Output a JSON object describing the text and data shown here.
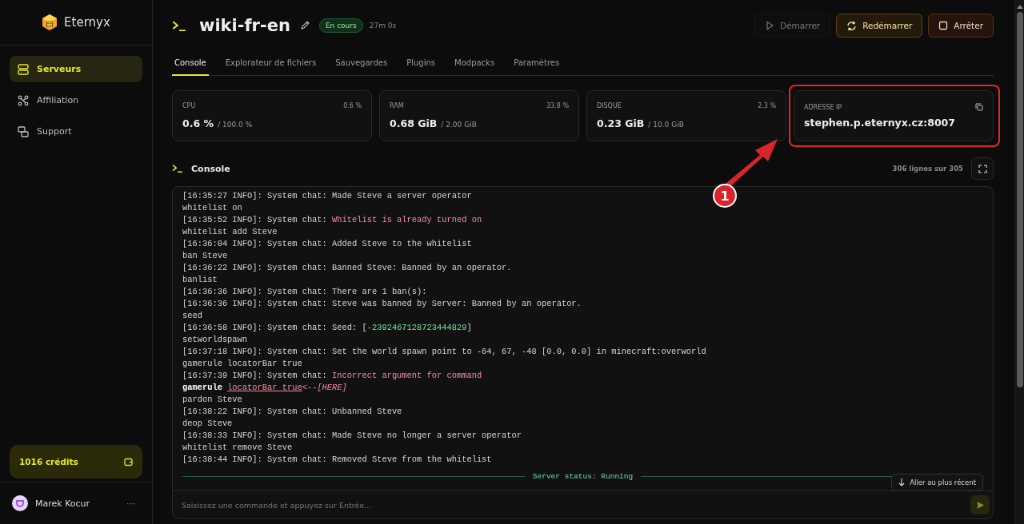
{
  "sidebar": {
    "brand": "Eternyx",
    "items": [
      {
        "label": "Serveurs",
        "selected": true
      },
      {
        "label": "Affiliation",
        "selected": false
      },
      {
        "label": "Support",
        "selected": false
      }
    ],
    "credits": "1016 crédits",
    "user": {
      "name": "Marek Kocur",
      "more": "···"
    }
  },
  "header": {
    "title": "wiki-fr-en",
    "status": "En cours",
    "uptime": "27m 0s",
    "buttons": [
      {
        "label": "Démarrer",
        "kind": "start",
        "disabled": true
      },
      {
        "label": "Redémarrer",
        "kind": "restart",
        "disabled": false
      },
      {
        "label": "Arrêter",
        "kind": "stop",
        "disabled": false
      }
    ]
  },
  "tabs": [
    {
      "label": "Console",
      "selected": true
    },
    {
      "label": "Explorateur de fichiers",
      "selected": false
    },
    {
      "label": "Sauvegardes",
      "selected": false
    },
    {
      "label": "Plugins",
      "selected": false
    },
    {
      "label": "Modpacks",
      "selected": false
    },
    {
      "label": "Paramètres",
      "selected": false
    }
  ],
  "stats": [
    {
      "kind": "usage",
      "label": "CPU",
      "percent": "0.6 %",
      "value": "0.6 %",
      "total": "/ 100.0 %"
    },
    {
      "kind": "usage",
      "label": "RAM",
      "percent": "33.8 %",
      "value": "0.68 GiB",
      "total": "/ 2.00 GiB"
    },
    {
      "kind": "usage",
      "label": "DISQUE",
      "percent": "2.3 %",
      "value": "0.23 GiB",
      "total": "/ 10.0 GiB"
    },
    {
      "kind": "address",
      "label": "ADRESSE IP",
      "value": "stephen.p.eternyx.cz:8007"
    }
  ],
  "annotation": {
    "number": "1"
  },
  "console": {
    "title": "Console",
    "line_count": "306 lignes sur 305",
    "lines": [
      [
        {
          "text": "[16:35:27 INFO]: System chat: Made Steve a server operator",
          "kind": "plain"
        }
      ],
      [
        {
          "text": "whitelist on",
          "kind": "plain"
        }
      ],
      [
        {
          "text": "[16:35:52 INFO]: System chat: ",
          "kind": "plain"
        },
        {
          "text": "Whitelist is already turned on",
          "kind": "error"
        }
      ],
      [
        {
          "text": "whitelist add Steve",
          "kind": "plain"
        }
      ],
      [
        {
          "text": "[16:36:04 INFO]: System chat: Added Steve to the whitelist",
          "kind": "plain"
        }
      ],
      [
        {
          "text": "ban Steve",
          "kind": "plain"
        }
      ],
      [
        {
          "text": "[16:36:22 INFO]: System chat: Banned Steve: Banned by an operator.",
          "kind": "plain"
        }
      ],
      [
        {
          "text": "banlist",
          "kind": "plain"
        }
      ],
      [
        {
          "text": "[16:36:36 INFO]: System chat: There are 1 ban(s):",
          "kind": "plain"
        }
      ],
      [
        {
          "text": "[16:36:36 INFO]: System chat: Steve was banned by Server: Banned by an operator.",
          "kind": "plain"
        }
      ],
      [
        {
          "text": "seed",
          "kind": "plain"
        }
      ],
      [
        {
          "text": "[16:36:58 INFO]: System chat: Seed: [",
          "kind": "plain"
        },
        {
          "text": "-2392467128723444829",
          "kind": "number"
        },
        {
          "text": "]",
          "kind": "plain"
        }
      ],
      [
        {
          "text": "setworldspawn",
          "kind": "plain"
        }
      ],
      [
        {
          "text": "[16:37:18 INFO]: System chat: Set the world spawn point to -64, 67, -48 [0.0, 0.0] in minecraft:overworld",
          "kind": "plain"
        }
      ],
      [
        {
          "text": "gamerule locatorBar true",
          "kind": "plain"
        }
      ],
      [
        {
          "text": "[16:37:39 INFO]: System chat: ",
          "kind": "plain"
        },
        {
          "text": "Incorrect argument for command",
          "kind": "error"
        }
      ],
      [
        {
          "text": "gamerule ",
          "kind": "bold"
        },
        {
          "text": "locatorBar true",
          "kind": "error-underline"
        },
        {
          "text": "<--",
          "kind": "error"
        },
        {
          "text": "[HERE]",
          "kind": "error-italic"
        }
      ],
      [
        {
          "text": "pardon Steve",
          "kind": "plain"
        }
      ],
      [
        {
          "text": "[16:38:22 INFO]: System chat: Unbanned Steve",
          "kind": "plain"
        }
      ],
      [
        {
          "text": "deop Steve",
          "kind": "plain"
        }
      ],
      [
        {
          "text": "[16:38:33 INFO]: System chat: Made Steve no longer a server operator",
          "kind": "plain"
        }
      ],
      [
        {
          "text": "whitelist remove Steve",
          "kind": "plain"
        }
      ],
      [
        {
          "text": "[16:38:44 INFO]: System chat: Removed Steve from the whitelist",
          "kind": "plain"
        }
      ]
    ],
    "status": "Server status: Running",
    "jump": "Aller au plus récent",
    "input": {
      "placeholder": "Saisissez une commande et appuyez sur Entrée..."
    }
  }
}
